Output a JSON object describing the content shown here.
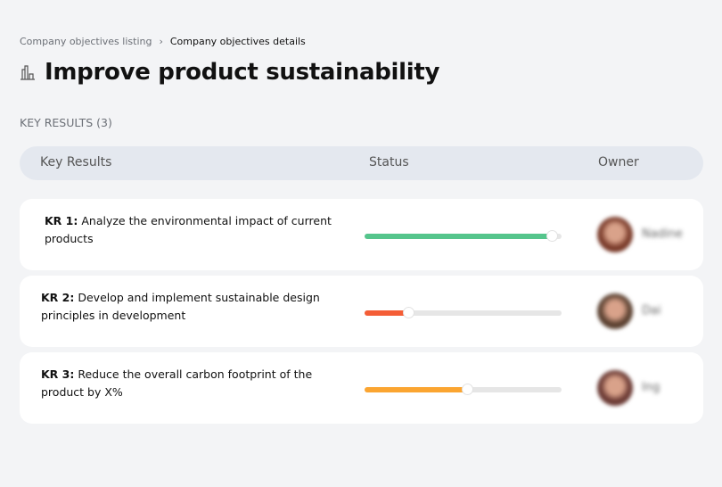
{
  "breadcrumb": {
    "parent": "Company objectives listing",
    "separator": "›",
    "current": "Company objectives details"
  },
  "page": {
    "icon": "buildings-icon",
    "title": "Improve product sustainability"
  },
  "section_label": "KEY RESULTS (3)",
  "table": {
    "headers": [
      "Key Results",
      "Status",
      "Owner"
    ],
    "rows": [
      {
        "id": "KR 1:",
        "text": "Analyze the environmental impact of current products",
        "progress": 95,
        "color": "#55c58c",
        "owner": "Nadine",
        "avatar": "#7a3b2a"
      },
      {
        "id": "KR 2:",
        "text": "Develop and implement sustainable design principles in development",
        "progress": 22,
        "color": "#f45d36",
        "owner": "Dai",
        "avatar": "#5a4030"
      },
      {
        "id": "KR 3:",
        "text": "Reduce the overall carbon footprint of the product by X%",
        "progress": 52,
        "color": "#fba531",
        "owner": "Ing",
        "avatar": "#6b3a34"
      }
    ]
  }
}
